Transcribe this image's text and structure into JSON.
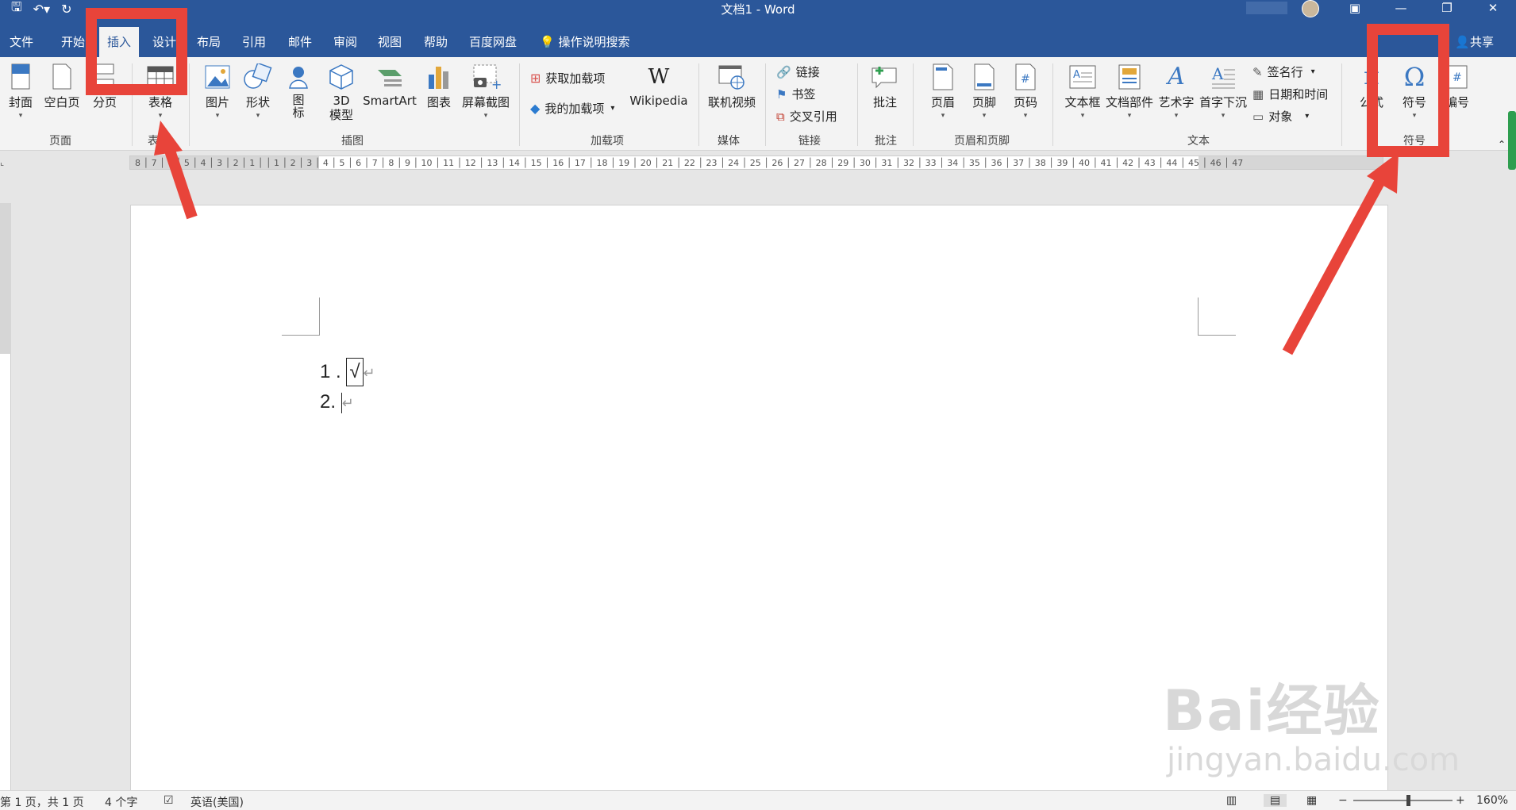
{
  "window": {
    "title": "文档1  -  Word"
  },
  "tabs": {
    "file": "文件",
    "home": "开始",
    "insert": "插入",
    "design": "设计",
    "layout": "布局",
    "references": "引用",
    "mailings": "邮件",
    "review": "审阅",
    "view": "视图",
    "help": "帮助",
    "baidu": "百度网盘",
    "tell_me": "操作说明搜索",
    "share": "共享"
  },
  "ribbon": {
    "pages": {
      "cover": "封面",
      "blank": "空白页",
      "break": "分页",
      "group": "页面"
    },
    "tables": {
      "table": "表格",
      "group": "表"
    },
    "illustrations": {
      "pictures": "图片",
      "shapes": "形状",
      "icons": "图标",
      "model3d": "3D 模型",
      "smartart": "SmartArt",
      "chart": "图表",
      "screenshot": "屏幕截图",
      "group": "插图"
    },
    "addins": {
      "get": "获取加载项",
      "mine": "我的加载项",
      "wikipedia": "Wikipedia",
      "group": "加载项"
    },
    "media": {
      "video": "联机视频",
      "group": "媒体"
    },
    "links": {
      "link": "链接",
      "bookmark": "书签",
      "crossref": "交叉引用",
      "group": "链接"
    },
    "comments": {
      "comment": "批注",
      "group": "批注"
    },
    "header_footer": {
      "header": "页眉",
      "footer": "页脚",
      "page_number": "页码",
      "group": "页眉和页脚"
    },
    "text": {
      "textbox": "文本框",
      "quickparts": "文档部件",
      "wordart": "艺术字",
      "dropcap": "首字下沉",
      "signature": "签名行",
      "datetime": "日期和时间",
      "object": "对象",
      "group": "文本"
    },
    "symbols": {
      "equation": "公式",
      "symbol": "符号",
      "number": "编号",
      "group": "符号"
    }
  },
  "ruler_ticks": "8 │ 7 │ 6 │ 5 │ 4 │ 3 │ 2 │ 1 │   │ 1 │ 2 │ 3 │ 4 │ 5 │ 6 │ 7 │ 8 │ 9 │ 10 │ 11 │ 12 │ 13 │ 14 │ 15 │ 16 │ 17 │ 18 │ 19 │ 20 │ 21 │ 22 │ 23 │ 24 │ 25 │ 26 │ 27 │ 28 │ 29 │ 30 │ 31 │ 32 │ 33 │ 34 │ 35 │ 36 │ 37 │ 38 │ 39 │ 40 │ 41 │ 42 │ 43 │ 44 │ 45 │ 46 │ 47",
  "document": {
    "line1_number": "1 .",
    "line1_symbol": "√",
    "line2_number": "2.",
    "para_mark": "↵"
  },
  "status": {
    "page": "第 1 页，共 1 页",
    "words": "4 个字",
    "language": "英语(美国)",
    "zoom": "160%"
  },
  "watermark": {
    "main": "Bai经验",
    "sub": "jingyan.baidu.com"
  },
  "colors": {
    "accent": "#2b579a",
    "annotation": "#e8443a"
  }
}
